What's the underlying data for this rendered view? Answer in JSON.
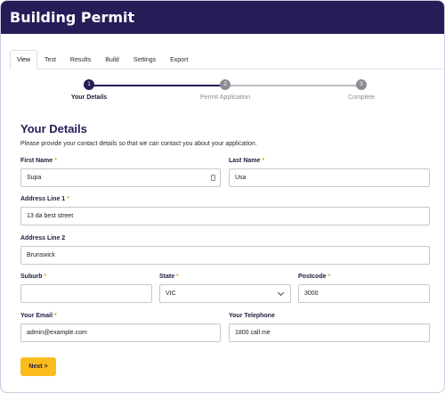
{
  "app": {
    "title": "Building Permit"
  },
  "tabs": [
    {
      "label": "View",
      "active": true
    },
    {
      "label": "Test"
    },
    {
      "label": "Results"
    },
    {
      "label": "Build"
    },
    {
      "label": "Settings"
    },
    {
      "label": "Export"
    }
  ],
  "stepper": {
    "steps": [
      {
        "number": "1",
        "label": "Your Details",
        "state": "current"
      },
      {
        "number": "2",
        "label": "Permit Application",
        "state": "upcoming"
      },
      {
        "number": "3",
        "label": "Complete",
        "state": "upcoming"
      }
    ],
    "colors": {
      "current": "#241d57",
      "upcoming": "#8c8c94",
      "line_done": "#241d57",
      "line_todo": "#bcbcc4"
    }
  },
  "form": {
    "title": "Your Details",
    "description": "Please provide your contact details so that we can contact you about your application.",
    "required_marker": "*",
    "fields": {
      "first_name": {
        "label": "First Name",
        "value": "Supa",
        "required": true
      },
      "last_name": {
        "label": "Last Name",
        "value": "Usa",
        "required": true
      },
      "address1": {
        "label": "Address Line 1",
        "value": "13 da best street",
        "required": true
      },
      "address2": {
        "label": "Address Line 2",
        "value": "Brunswick",
        "required": false
      },
      "suburb": {
        "label": "Suburb",
        "value": "",
        "required": true
      },
      "state": {
        "label": "State",
        "value": "VIC",
        "required": true
      },
      "postcode": {
        "label": "Postcode",
        "value": "3000",
        "required": true
      },
      "email": {
        "label": "Your Email",
        "value": "admin@example.com",
        "required": true
      },
      "telephone": {
        "label": "Your Telephone",
        "value": "1800 call me",
        "required": false
      }
    },
    "next_label": "Next >"
  },
  "colors": {
    "header_bg": "#241d57",
    "accent": "#fbbd1e",
    "required": "#e0a21b"
  }
}
